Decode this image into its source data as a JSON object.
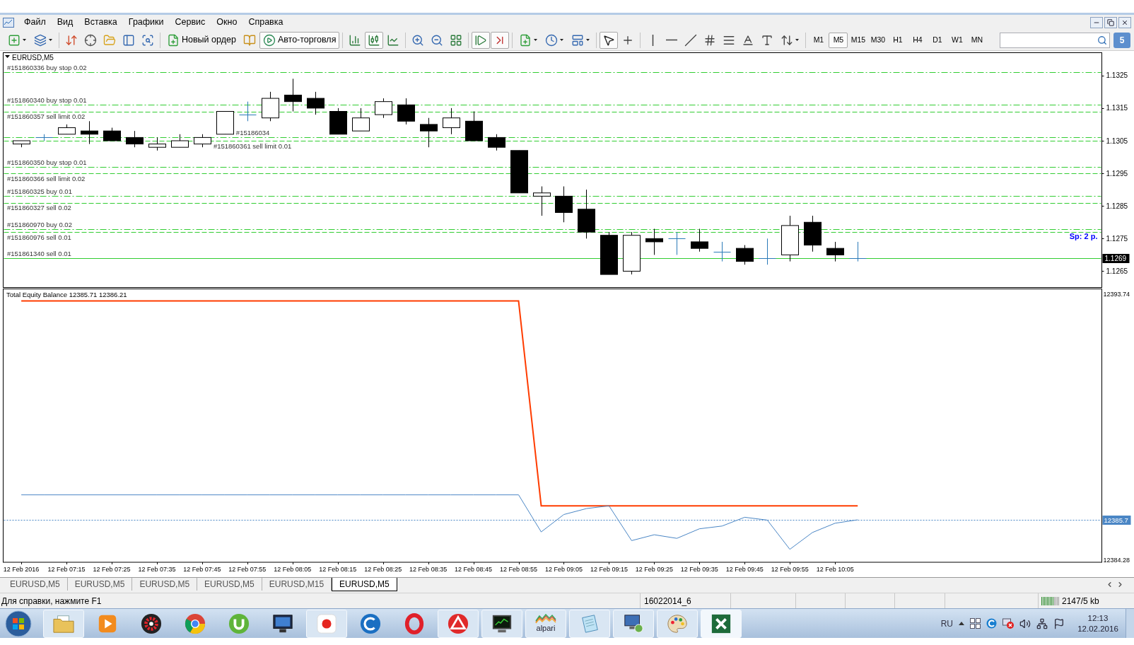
{
  "menu": [
    "Файл",
    "Вид",
    "Вставка",
    "Графики",
    "Сервис",
    "Окно",
    "Справка"
  ],
  "toolbar": {
    "groups": [
      [
        {
          "kind": "chart"
        },
        {
          "kind": "profiles"
        }
      ],
      [
        {
          "kind": "market"
        },
        {
          "kind": "datawin"
        },
        {
          "kind": "navigator"
        },
        {
          "kind": "terminal"
        },
        {
          "kind": "tester"
        }
      ],
      [
        {
          "kind": "order",
          "label": "Новый ордер"
        },
        {
          "kind": "editor"
        },
        {
          "kind": "autotrading",
          "label": "Авто-торговля",
          "selected": true
        }
      ],
      [
        {
          "kind": "bars",
          "selected": false
        },
        {
          "kind": "candles",
          "selected": true
        },
        {
          "kind": "line",
          "selected": false
        }
      ],
      [
        {
          "kind": "zoomin"
        },
        {
          "kind": "zoomout"
        },
        {
          "kind": "tile"
        }
      ],
      [
        {
          "kind": "shift",
          "selected": true
        },
        {
          "kind": "autoscroll",
          "selected": true
        }
      ],
      [
        {
          "kind": "indicators"
        },
        {
          "kind": "periods"
        },
        {
          "kind": "templates"
        }
      ],
      [
        {
          "kind": "cursor",
          "selected": true
        },
        {
          "kind": "cross",
          "selected": false
        }
      ],
      [
        {
          "kind": "vline"
        },
        {
          "kind": "hline"
        },
        {
          "kind": "trend"
        },
        {
          "kind": "channel"
        },
        {
          "kind": "fibo"
        },
        {
          "kind": "text"
        },
        {
          "kind": "label"
        },
        {
          "kind": "arrows"
        }
      ]
    ],
    "timeframes": [
      {
        "label": "M1",
        "selected": false
      },
      {
        "label": "M5",
        "selected": true
      },
      {
        "label": "M15",
        "selected": false
      },
      {
        "label": "M30",
        "selected": false
      },
      {
        "label": "H1",
        "selected": false
      },
      {
        "label": "H4",
        "selected": false
      },
      {
        "label": "D1",
        "selected": false
      },
      {
        "label": "W1",
        "selected": false
      },
      {
        "label": "MN",
        "selected": false
      }
    ],
    "messages": "5"
  },
  "chart_window": {
    "bid_label": "1.1269",
    "covered_labels": [
      "#15186034"
    ],
    "chart_data": [
      {
        "type": "candlestick",
        "title": "EURUSD,M5",
        "x": [
          "2016-02-12T07:05",
          "2016-02-12T07:10",
          "2016-02-12T07:15",
          "2016-02-12T07:20",
          "2016-02-12T07:25",
          "2016-02-12T07:30",
          "2016-02-12T07:35",
          "2016-02-12T07:40",
          "2016-02-12T07:45",
          "2016-02-12T07:50",
          "2016-02-12T07:55",
          "2016-02-12T08:00",
          "2016-02-12T08:05",
          "2016-02-12T08:10",
          "2016-02-12T08:15",
          "2016-02-12T08:20",
          "2016-02-12T08:25",
          "2016-02-12T08:30",
          "2016-02-12T08:35",
          "2016-02-12T08:40",
          "2016-02-12T08:45",
          "2016-02-12T08:50",
          "2016-02-12T08:55",
          "2016-02-12T09:00",
          "2016-02-12T09:05",
          "2016-02-12T09:10",
          "2016-02-12T09:15",
          "2016-02-12T09:20",
          "2016-02-12T09:25",
          "2016-02-12T09:30",
          "2016-02-12T09:35",
          "2016-02-12T09:40",
          "2016-02-12T09:45",
          "2016-02-12T09:50",
          "2016-02-12T09:55",
          "2016-02-12T10:00",
          "2016-02-12T10:05",
          "2016-02-12T10:10"
        ],
        "ohlc": [
          [
            1.1304,
            1.1305,
            1.1303,
            1.1305
          ],
          [
            1.1306,
            1.1307,
            1.1305,
            1.1306
          ],
          [
            1.1307,
            1.131,
            1.1307,
            1.1309
          ],
          [
            1.1308,
            1.1311,
            1.1304,
            1.1307
          ],
          [
            1.1308,
            1.1309,
            1.1305,
            1.1305
          ],
          [
            1.1306,
            1.1308,
            1.1303,
            1.1304
          ],
          [
            1.1303,
            1.1306,
            1.1302,
            1.1304
          ],
          [
            1.1303,
            1.1307,
            1.1303,
            1.1305
          ],
          [
            1.1304,
            1.1307,
            1.1303,
            1.1306
          ],
          [
            1.1307,
            1.1314,
            1.1307,
            1.1314
          ],
          [
            1.1313,
            1.1317,
            1.1311,
            1.1313
          ],
          [
            1.1312,
            1.132,
            1.1311,
            1.1318
          ],
          [
            1.1319,
            1.1324,
            1.1314,
            1.1317
          ],
          [
            1.1318,
            1.132,
            1.1313,
            1.1315
          ],
          [
            1.1314,
            1.1315,
            1.1307,
            1.1307
          ],
          [
            1.1308,
            1.1315,
            1.1308,
            1.1312
          ],
          [
            1.1313,
            1.1318,
            1.1312,
            1.1317
          ],
          [
            1.1316,
            1.1318,
            1.131,
            1.1311
          ],
          [
            1.131,
            1.1312,
            1.1303,
            1.1308
          ],
          [
            1.1309,
            1.1315,
            1.1307,
            1.1312
          ],
          [
            1.1311,
            1.1314,
            1.1305,
            1.1305
          ],
          [
            1.1306,
            1.1307,
            1.1302,
            1.1303
          ],
          [
            1.1302,
            1.1302,
            1.1289,
            1.1289
          ],
          [
            1.1288,
            1.1291,
            1.1282,
            1.1289
          ],
          [
            1.1288,
            1.1291,
            1.128,
            1.1283
          ],
          [
            1.1284,
            1.129,
            1.1275,
            1.1277
          ],
          [
            1.1276,
            1.1277,
            1.1264,
            1.1264
          ],
          [
            1.1265,
            1.1277,
            1.1264,
            1.1276
          ],
          [
            1.1275,
            1.1278,
            1.127,
            1.1274
          ],
          [
            1.1275,
            1.1277,
            1.127,
            1.1275
          ],
          [
            1.1274,
            1.1278,
            1.1271,
            1.1272
          ],
          [
            1.1271,
            1.1274,
            1.1268,
            1.1271
          ],
          [
            1.1272,
            1.1273,
            1.1267,
            1.1268
          ],
          [
            1.1269,
            1.1275,
            1.1267,
            1.1269
          ],
          [
            1.127,
            1.1282,
            1.1268,
            1.1279
          ],
          [
            1.128,
            1.1282,
            1.1271,
            1.1273
          ],
          [
            1.1272,
            1.1274,
            1.1268,
            1.127
          ],
          [
            1.1269,
            1.1274,
            1.1268,
            1.1269
          ]
        ],
        "xlim": [
          "2016-02-12T07:01",
          "2016-02-12T11:04"
        ],
        "ylim": [
          1.126,
          1.1332
        ],
        "yticks": [
          1.1325,
          1.1315,
          1.1305,
          1.1295,
          1.1285,
          1.1275,
          1.1265
        ],
        "ref_lines": [
          {
            "axis": "y",
            "value": 1.1326,
            "label": "#151860336 buy stop 0.02",
            "color": "#32cd32",
            "line_style": "dashdot"
          },
          {
            "axis": "y",
            "value": 1.1316,
            "label": "#151860340 buy stop 0.01",
            "color": "#32cd32",
            "line_style": "dashdot"
          },
          {
            "axis": "y",
            "value": 1.1314,
            "label": "#151860357 sell limit 0.02",
            "color": "#32cd32",
            "line_style": "dashed"
          },
          {
            "axis": "y",
            "value": 1.1306,
            "color": "#32cd32",
            "line_style": "dashdot"
          },
          {
            "axis": "y",
            "value": 1.1305,
            "label": "#151860361 sell limit 0.01",
            "color": "#32cd32",
            "line_style": "dashed"
          },
          {
            "axis": "y",
            "value": 1.1297,
            "label": "#151860350 buy stop 0.01",
            "color": "#32cd32",
            "line_style": "dashdot"
          },
          {
            "axis": "y",
            "value": 1.1295,
            "label": "#151860366 sell limit 0.02",
            "color": "#32cd32",
            "line_style": "dashed"
          },
          {
            "axis": "y",
            "value": 1.1288,
            "label": "#151860325 buy 0.01",
            "color": "#32cd32",
            "line_style": "dashdot"
          },
          {
            "axis": "y",
            "value": 1.1286,
            "label": "#151860327 sell 0.02",
            "color": "#32cd32",
            "line_style": "dashed"
          },
          {
            "axis": "y",
            "value": 1.1278,
            "label": "#151860970 buy 0.02",
            "color": "#32cd32",
            "line_style": "dashdot"
          },
          {
            "axis": "y",
            "value": 1.1277,
            "label": "#151860976 sell 0.01",
            "color": "#32cd32",
            "line_style": "dashed"
          },
          {
            "axis": "y",
            "value": 1.1269,
            "label": "#151861340 sell 0.01",
            "color": "#32cd32",
            "line_style": "solid"
          }
        ],
        "annotations": [
          "Sp: 2 p."
        ]
      },
      {
        "type": "line",
        "title": "Total Equity Balance 12385.71 12386.21",
        "x": [
          "2016-02-12T07:05",
          "2016-02-12T07:10",
          "2016-02-12T07:15",
          "2016-02-12T07:20",
          "2016-02-12T07:25",
          "2016-02-12T07:30",
          "2016-02-12T07:35",
          "2016-02-12T07:40",
          "2016-02-12T07:45",
          "2016-02-12T07:50",
          "2016-02-12T07:55",
          "2016-02-12T08:00",
          "2016-02-12T08:05",
          "2016-02-12T08:10",
          "2016-02-12T08:15",
          "2016-02-12T08:20",
          "2016-02-12T08:25",
          "2016-02-12T08:30",
          "2016-02-12T08:35",
          "2016-02-12T08:40",
          "2016-02-12T08:45",
          "2016-02-12T08:50",
          "2016-02-12T08:55",
          "2016-02-12T09:00",
          "2016-02-12T09:05",
          "2016-02-12T09:10",
          "2016-02-12T09:15",
          "2016-02-12T09:20",
          "2016-02-12T09:25",
          "2016-02-12T09:30",
          "2016-02-12T09:35",
          "2016-02-12T09:40",
          "2016-02-12T09:45",
          "2016-02-12T09:50",
          "2016-02-12T09:55",
          "2016-02-12T10:00",
          "2016-02-12T10:05",
          "2016-02-12T10:10"
        ],
        "xticks": [
          {
            "value": "2016-02-12T07:05",
            "label": "12 Feb 2016"
          },
          {
            "value": "2016-02-12T07:15",
            "label": "12 Feb 07:15"
          },
          {
            "value": "2016-02-12T07:25",
            "label": "12 Feb 07:25"
          },
          {
            "value": "2016-02-12T07:35",
            "label": "12 Feb 07:35"
          },
          {
            "value": "2016-02-12T07:45",
            "label": "12 Feb 07:45"
          },
          {
            "value": "2016-02-12T07:55",
            "label": "12 Feb 07:55"
          },
          {
            "value": "2016-02-12T08:05",
            "label": "12 Feb 08:05"
          },
          {
            "value": "2016-02-12T08:15",
            "label": "12 Feb 08:15"
          },
          {
            "value": "2016-02-12T08:25",
            "label": "12 Feb 08:25"
          },
          {
            "value": "2016-02-12T08:35",
            "label": "12 Feb 08:35"
          },
          {
            "value": "2016-02-12T08:45",
            "label": "12 Feb 08:45"
          },
          {
            "value": "2016-02-12T08:55",
            "label": "12 Feb 08:55"
          },
          {
            "value": "2016-02-12T09:05",
            "label": "12 Feb 09:05"
          },
          {
            "value": "2016-02-12T09:15",
            "label": "12 Feb 09:15"
          },
          {
            "value": "2016-02-12T09:25",
            "label": "12 Feb 09:25"
          },
          {
            "value": "2016-02-12T09:35",
            "label": "12 Feb 09:35"
          },
          {
            "value": "2016-02-12T09:45",
            "label": "12 Feb 09:45"
          },
          {
            "value": "2016-02-12T09:55",
            "label": "12 Feb 09:55"
          },
          {
            "value": "2016-02-12T10:05",
            "label": "12 Feb 10:05"
          }
        ],
        "series": [
          {
            "color": "#ff3c00",
            "values": [
              12393.5,
              12393.5,
              12393.5,
              12393.5,
              12393.5,
              12393.5,
              12393.5,
              12393.5,
              12393.5,
              12393.5,
              12393.5,
              12393.5,
              12393.5,
              12393.5,
              12393.5,
              12393.5,
              12393.5,
              12393.5,
              12393.5,
              12393.5,
              12393.5,
              12393.5,
              12393.5,
              12386.21,
              12386.21,
              12386.21,
              12386.21,
              12386.21,
              12386.21,
              12386.21,
              12386.21,
              12386.21,
              12386.21,
              12386.21,
              12386.21,
              12386.21,
              12386.21,
              12386.21
            ]
          },
          {
            "color": "#4a86c5",
            "values": [
              12386.6,
              12386.6,
              12386.6,
              12386.6,
              12386.6,
              12386.6,
              12386.6,
              12386.6,
              12386.6,
              12386.6,
              12386.6,
              12386.6,
              12386.6,
              12386.6,
              12386.6,
              12386.6,
              12386.6,
              12386.6,
              12386.6,
              12386.6,
              12386.6,
              12386.6,
              12386.6,
              12385.28,
              12385.9,
              12386.11,
              12386.21,
              12384.97,
              12385.18,
              12385.05,
              12385.39,
              12385.49,
              12385.8,
              12385.7,
              12384.66,
              12385.26,
              12385.59,
              12385.71
            ]
          }
        ],
        "xlim": [
          "2016-02-12T07:01",
          "2016-02-12T11:04"
        ],
        "ylim": [
          12384.2,
          12393.93
        ],
        "yticks": [
          12393.74,
          12384.28
        ],
        "ref_lines": [
          {
            "axis": "y",
            "value": 12385.71,
            "label": "12385.7",
            "color": "#4a86c5",
            "line_style": "dotted"
          }
        ]
      }
    ]
  },
  "tabs": [
    {
      "label": "EURUSD,M5",
      "selected": false
    },
    {
      "label": "EURUSD,M5",
      "selected": false
    },
    {
      "label": "EURUSD,M5",
      "selected": false
    },
    {
      "label": "EURUSD,M5",
      "selected": false
    },
    {
      "label": "EURUSD,M15",
      "selected": false
    },
    {
      "label": "EURUSD,M5",
      "selected": true
    }
  ],
  "status_bar": {
    "help": "Для справки, нажмите F1",
    "profile": "16022014_6",
    "traffic": "2147/5 kb"
  },
  "taskbar": {
    "apps": [
      {
        "kind": "folder",
        "running": true,
        "selected": false
      },
      {
        "kind": "player",
        "running": false,
        "selected": false
      },
      {
        "kind": "gear",
        "running": false,
        "selected": false
      },
      {
        "kind": "sphere",
        "running": false,
        "selected": false
      },
      {
        "kind": "cup",
        "running": false,
        "selected": false
      },
      {
        "kind": "screen",
        "running": false,
        "selected": false
      },
      {
        "kind": "tile",
        "running": true,
        "selected": false
      },
      {
        "kind": "swirl",
        "running": false,
        "selected": false
      },
      {
        "kind": "ring",
        "running": false,
        "selected": false
      },
      {
        "kind": "triangle",
        "running": true,
        "selected": false
      },
      {
        "kind": "terminal",
        "running": true,
        "selected": false
      },
      {
        "kind": "waves",
        "label": "alpari",
        "running": true,
        "selected": false
      },
      {
        "kind": "notepad",
        "running": true,
        "selected": false
      },
      {
        "kind": "network",
        "running": true,
        "selected": false
      },
      {
        "kind": "palette",
        "running": true,
        "selected": false
      },
      {
        "kind": "sheet",
        "running": true,
        "selected": true
      }
    ],
    "tray": {
      "language": "RU",
      "time": "12:13",
      "date": "12.02.2016"
    }
  }
}
